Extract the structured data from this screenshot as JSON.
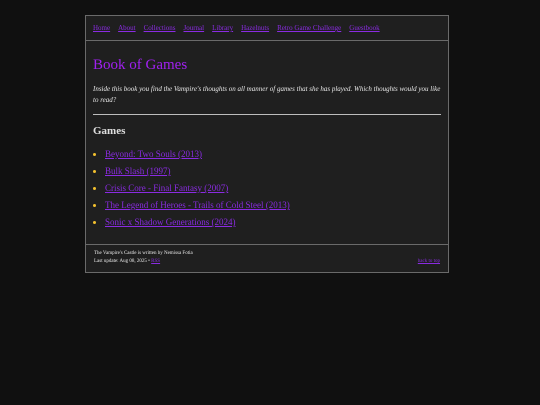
{
  "nav": {
    "items": [
      "Home",
      "About",
      "Collections",
      "Journal",
      "Library",
      "Hazelnuts",
      "Retro Game Challenge",
      "Guestbook"
    ]
  },
  "page": {
    "title": "Book of Games",
    "intro": "Inside this book you find the Vampire's thoughts on all manner of games that she has played. Which thoughts would you like to read?",
    "section_heading": "Games"
  },
  "games": [
    "Beyond: Two Souls (2013)",
    "Bulk Slash (1997)",
    "Crisis Core - Final Fantasy (2007)",
    "The Legend of Heroes - Trails of Cold Steel (2013)",
    "Sonic x Shadow Generations (2024)"
  ],
  "footer": {
    "credit": "The Vampire's Castle is written by Nemissa Fotia",
    "last_update": "Last update: Aug 08, 2025 •",
    "rss": "RSS",
    "back_to_top": "back to top"
  },
  "colors": {
    "background": "#101010",
    "panel": "#1f1f1f",
    "title": "#a020f0",
    "link": "#8a2be2",
    "bullet": "#f2c02e"
  }
}
